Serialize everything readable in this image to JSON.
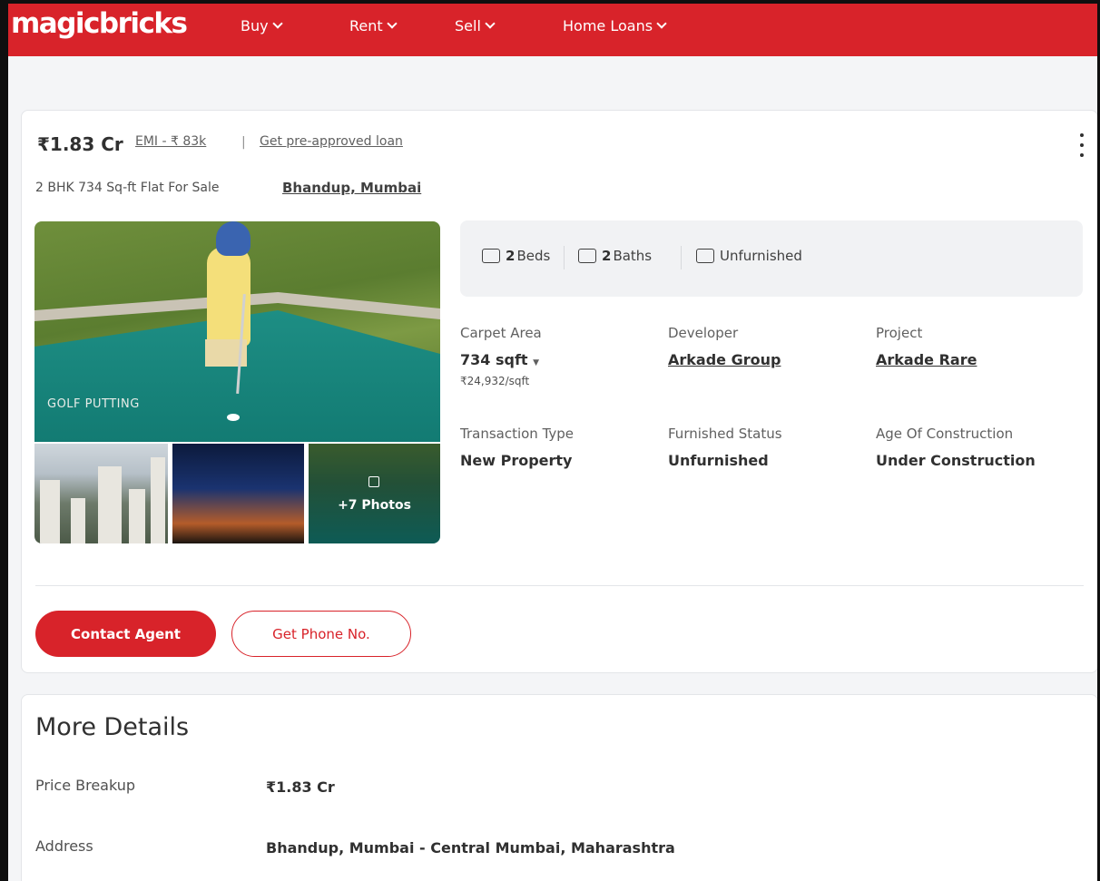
{
  "header": {
    "logo": "magicbricks",
    "nav": [
      {
        "label": "Buy"
      },
      {
        "label": "Rent"
      },
      {
        "label": "Sell"
      },
      {
        "label": "Home Loans"
      }
    ]
  },
  "listing": {
    "price": "₹1.83 Cr",
    "emi": "EMI - ₹ 83k",
    "separator": "|",
    "preapproved": "Get pre-approved loan",
    "subtitle": "2 BHK 734 Sq-ft Flat For Sale",
    "location": "Bhandup, Mumbai",
    "gallery": {
      "main_caption": "GOLF PUTTING",
      "more_photos": "+7 Photos"
    },
    "amenities": [
      {
        "value": "2",
        "label": "Beds",
        "icon": "bed-icon"
      },
      {
        "value": "2",
        "label": "Baths",
        "icon": "bath-icon"
      },
      {
        "value": "",
        "label": "Unfurnished",
        "icon": "furnishing-icon"
      }
    ],
    "specs": {
      "carpet_area_label": "Carpet Area",
      "carpet_area_value": "734 sqft",
      "carpet_area_rate": "₹24,932/sqft",
      "developer_label": "Developer",
      "developer_value": "Arkade Group",
      "project_label": "Project",
      "project_value": "Arkade Rare",
      "transaction_label": "Transaction Type",
      "transaction_value": "New Property",
      "furnished_label": "Furnished Status",
      "furnished_value": "Unfurnished",
      "age_label": "Age Of Construction",
      "age_value": "Under Construction"
    },
    "actions": {
      "contact": "Contact Agent",
      "phone": "Get Phone No."
    }
  },
  "more_details": {
    "title": "More Details",
    "rows": [
      {
        "label": "Price Breakup",
        "value": "₹1.83 Cr"
      },
      {
        "label": "Address",
        "value": "Bhandup, Mumbai - Central Mumbai, Maharashtra"
      }
    ]
  },
  "colors": {
    "brand": "#d8232a",
    "text": "#303030",
    "muted": "#606060"
  }
}
